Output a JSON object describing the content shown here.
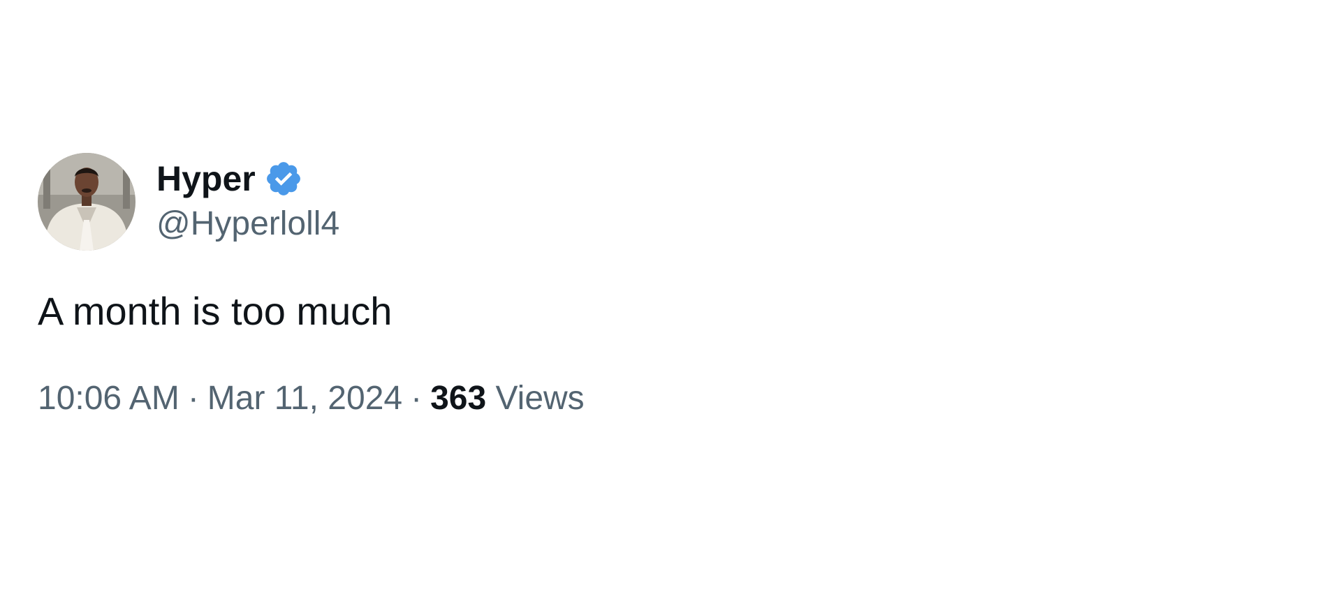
{
  "tweet": {
    "author": {
      "display_name": "Hyper",
      "handle": "@Hyperloll4",
      "verified": true,
      "verified_badge_color": "#4a99e9",
      "avatar_icon": "profile-photo"
    },
    "text": "A month is too much",
    "time": "10:06 AM",
    "separator": "·",
    "date": "Mar 11, 2024",
    "views_count": "363",
    "views_label": "Views"
  },
  "colors": {
    "primary_text": "#0f1419",
    "secondary_text": "#536471",
    "background": "#ffffff"
  }
}
